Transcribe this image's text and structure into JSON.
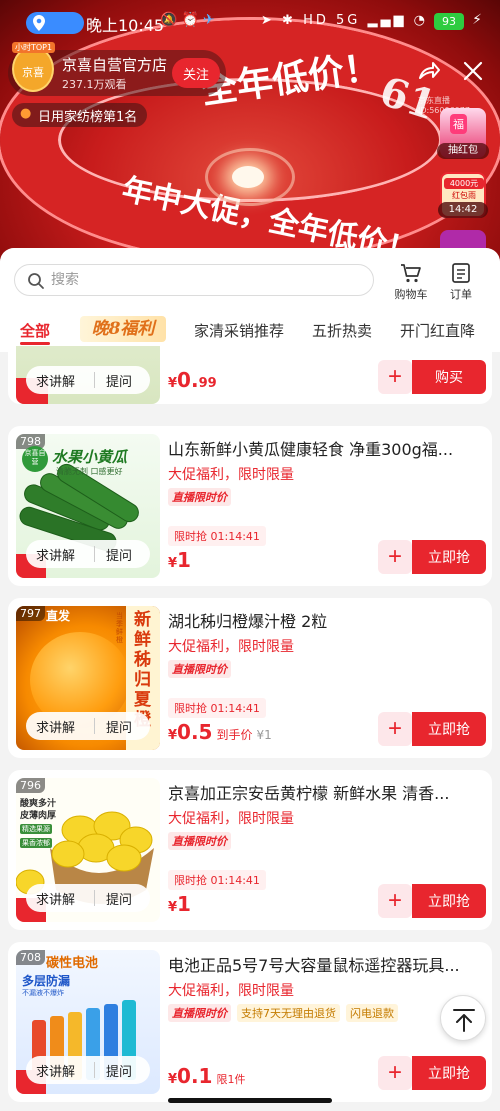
{
  "status_bar": {
    "time": "晚上10:45",
    "network": "5G",
    "battery": "93"
  },
  "store": {
    "badge": "小时TOP1",
    "logo_text": "京喜",
    "name": "京喜自营官方店",
    "views": "237.1万观看",
    "follow_label": "关注",
    "rank": "日用家纺榜第1名",
    "tiny_id": "京东直播ID:56006077"
  },
  "banner": {
    "ring_text_1": "全年低价！",
    "ring_text_2": "年中大促，全年低价！",
    "ring_text_3": "61",
    "ring_text_4": "61"
  },
  "side_widgets": {
    "redpack_mark": "福",
    "redpack_label": "抽红包",
    "timer_amount": "4000元",
    "timer_text": "红包雨",
    "timer_countdown": "14:42"
  },
  "search": {
    "placeholder": "搜索"
  },
  "top_actions": {
    "cart": "购物车",
    "orders": "订单"
  },
  "tabs": [
    "全部",
    "晚8福利",
    "家清采销推荐",
    "五折热卖",
    "开门红直降"
  ],
  "qa": {
    "explain": "求讲解",
    "ask": "提问"
  },
  "products": [
    {
      "price_yen": "¥",
      "price": "0.",
      "price_tail": "99",
      "add": "+",
      "action": "购买"
    },
    {
      "index": "798",
      "thumb_title": "水果小黄瓜",
      "thumb_sub": "清脆无刺 口感更好",
      "thumb_badge": "京喜自营",
      "title": "山东新鲜小黄瓜健康轻食 净重300g福...",
      "promo": "大促福利，限时限量",
      "tags": [
        "直播限时价"
      ],
      "countdown": "限时抢  01:14:41",
      "price_yen": "¥",
      "price": "1",
      "add": "+",
      "action": "立即抢"
    },
    {
      "index": "797",
      "thumb_title": "新鲜秭归夏橙",
      "thumb_badge": "直发",
      "thumb_note": "当季鲜橙",
      "title": "湖北秭归橙爆汁橙 2粒",
      "promo": "大促福利，限时限量",
      "tags": [
        "直播限时价"
      ],
      "countdown": "限时抢  01:14:41",
      "price_yen": "¥",
      "price": "0.5",
      "price_sub": "到手价",
      "price_orig": "¥1",
      "add": "+",
      "action": "立即抢"
    },
    {
      "index": "796",
      "thumb_title": "皮薄肉厚",
      "thumb_sub": "酸爽多汁",
      "thumb_tags": [
        "精选果源",
        "果香浓郁"
      ],
      "title": "京喜加正宗安岳黄柠檬 新鲜水果 清香...",
      "promo": "大促福利，限时限量",
      "tags": [
        "直播限时价"
      ],
      "countdown": "限时抢  01:14:41",
      "price_yen": "¥",
      "price": "1",
      "add": "+",
      "action": "立即抢"
    },
    {
      "index": "708",
      "thumb_title": "碳性电池",
      "thumb_sub": "多层防漏",
      "thumb_note": "不漏液不爆炸",
      "title": "电池正品5号7号大容量鼠标遥控器玩具...",
      "promo": "大促福利，限时限量",
      "tags": [
        "直播限时价",
        "支持7天无理由退货",
        "闪电退款"
      ],
      "price_yen": "¥",
      "price": "0.1",
      "price_note": "限1件",
      "add": "+",
      "action": "立即抢"
    }
  ]
}
